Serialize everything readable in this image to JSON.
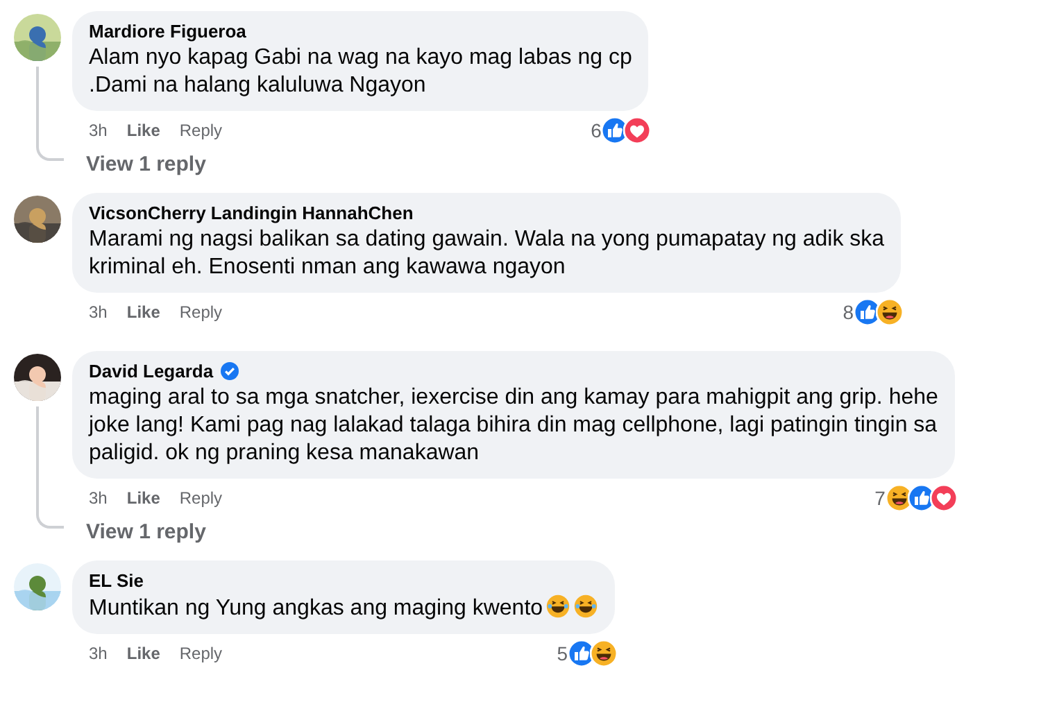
{
  "comments": [
    {
      "author": "Mardiore Figueroa",
      "verified": false,
      "text": "Alam nyo kapag Gabi na wag na kayo mag labas ng cp\n.Dami na halang kaluluwa Ngayon",
      "time": "3h",
      "like": "Like",
      "reply": "Reply",
      "reaction_count": "6",
      "reactions": [
        {
          "kind": "like"
        },
        {
          "kind": "love"
        }
      ],
      "view_replies": "View 1 reply"
    },
    {
      "author": "VicsonCherry Landingin HannahChen",
      "verified": false,
      "text": "Marami ng nagsi balikan sa dating gawain. Wala na yong pumapatay ng adik ska\nkriminal eh. Enosenti nman ang kawawa ngayon",
      "time": "3h",
      "like": "Like",
      "reply": "Reply",
      "reaction_count": "8",
      "reactions": [
        {
          "kind": "like"
        },
        {
          "kind": "haha"
        }
      ]
    },
    {
      "author": "David Legarda",
      "verified": true,
      "text": "maging aral to sa mga snatcher, iexercise din ang kamay para mahigpit ang grip. hehe\njoke lang! Kami pag nag lalakad talaga bihira din mag cellphone, lagi patingin tingin sa\npaligid. ok ng praning kesa manakawan",
      "time": "3h",
      "like": "Like",
      "reply": "Reply",
      "reaction_count": "7",
      "reactions": [
        {
          "kind": "haha"
        },
        {
          "kind": "like"
        },
        {
          "kind": "love"
        }
      ],
      "view_replies": "View 1 reply"
    },
    {
      "author": "EL Sie",
      "verified": false,
      "text": "Muntikan ng Yung angkas ang maging kwento",
      "inline_emoji": [
        {
          "kind": "haha"
        },
        {
          "kind": "haha"
        }
      ],
      "time": "3h",
      "like": "Like",
      "reply": "Reply",
      "reaction_count": "5",
      "reactions": [
        {
          "kind": "like"
        },
        {
          "kind": "haha"
        }
      ]
    }
  ]
}
